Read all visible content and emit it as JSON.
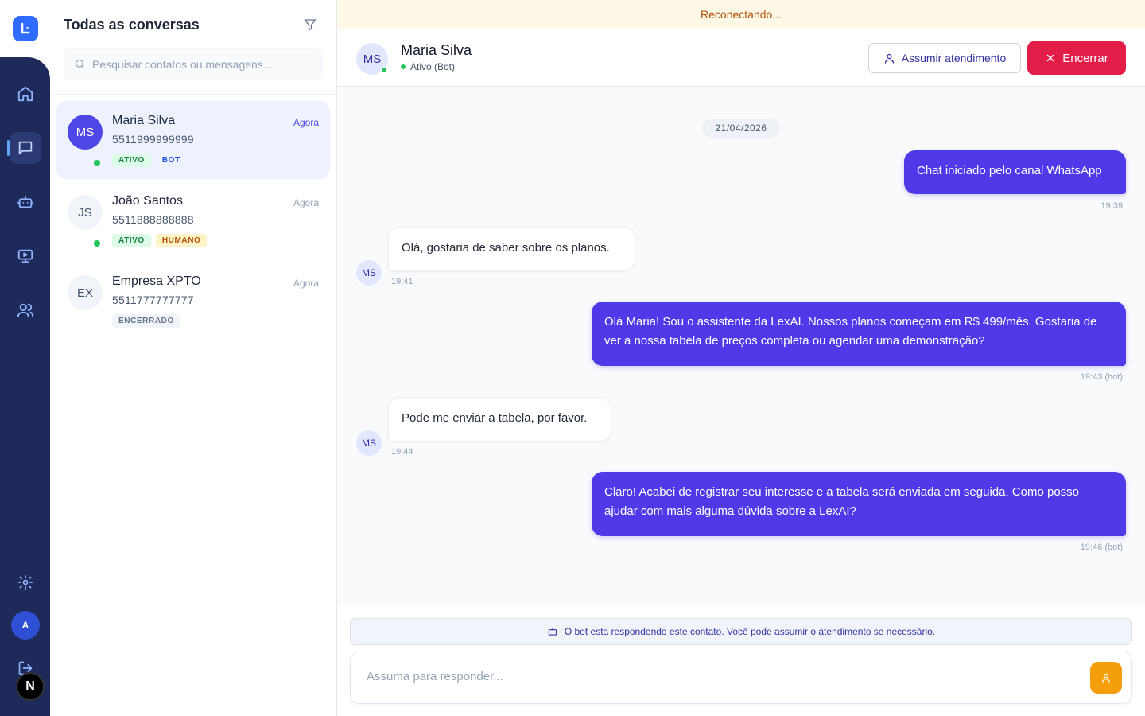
{
  "rail": {
    "logo_letter": "L",
    "avatar_initial": "A",
    "badge_letter": "N",
    "items": [
      "home-icon",
      "chat-icon",
      "bot-icon",
      "monitor-icon",
      "users-icon",
      "settings-icon",
      "logout-icon"
    ]
  },
  "list": {
    "title": "Todas as conversas",
    "search_placeholder": "Pesquisar contatos ou mensagens...",
    "conversations": [
      {
        "initials": "MS",
        "name": "Maria Silva",
        "phone": "5511999999999",
        "time": "Agora",
        "tags": [
          "ATIVO",
          "BOT"
        ],
        "online": true
      },
      {
        "initials": "JS",
        "name": "João Santos",
        "phone": "5511888888888",
        "time": "Agora",
        "tags": [
          "ATIVO",
          "HUMANO"
        ],
        "online": true
      },
      {
        "initials": "EX",
        "name": "Empresa XPTO",
        "phone": "5511777777777",
        "time": "Agora",
        "tags": [
          "ENCERRADO"
        ],
        "online": false
      }
    ]
  },
  "banner": {
    "text": "Reconectando..."
  },
  "chat": {
    "contact_initials": "MS",
    "contact_name": "Maria Silva",
    "contact_status": "Ativo (Bot)",
    "assume_label": "Assumir atendimento",
    "end_label": "Encerrar",
    "date": "21/04/2026",
    "messages": [
      {
        "dir": "out",
        "text": "Chat iniciado pelo canal WhatsApp",
        "meta": "19:39"
      },
      {
        "dir": "in",
        "avatar": "MS",
        "text": "Olá, gostaria de saber sobre os planos.",
        "meta": "19:41"
      },
      {
        "dir": "out",
        "text": "Olá Maria! Sou o assistente da LexAI. Nossos planos começam em R$ 499/mês. Gostaria de ver a nossa tabela de preços completa ou agendar uma demonstração?",
        "meta": "19:43 (bot)"
      },
      {
        "dir": "in",
        "avatar": "MS",
        "text": "Pode me enviar a tabela, por favor.",
        "meta": "19:44"
      },
      {
        "dir": "out",
        "text": "Claro! Acabei de registrar seu interesse e a tabela será enviada em seguida. Como posso ajudar com mais alguma dúvida sobre a LexAI?",
        "meta": "19:46 (bot)"
      }
    ],
    "bot_notice": "O bot esta respondendo este contato. Você pode assumir o atendimento se necessário.",
    "reply_placeholder": "Assuma para responder..."
  },
  "colors": {
    "accent": "#4f39e8",
    "danger": "#e11d48",
    "rail": "#1e2a5a",
    "warning": "#f59e0b"
  }
}
